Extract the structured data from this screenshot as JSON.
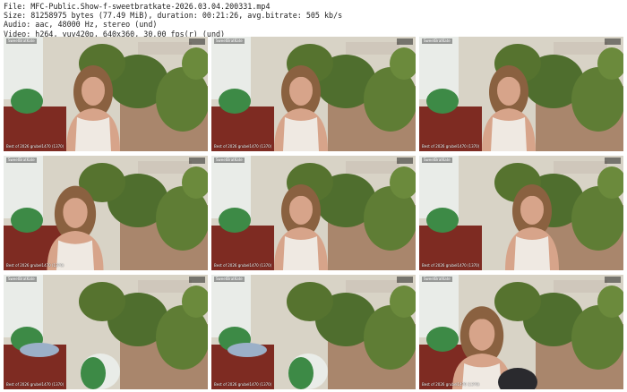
{
  "file_info": {
    "file": "File: MFC-Public.Show-f-sweetbratkate-2026.03.04.200331.mp4",
    "size": "Size: 81258975 bytes (77.49 MiB), duration: 00:21:26, avg.bitrate: 505 kb/s",
    "audio": "Audio: aac, 48000 Hz, stereo (und)",
    "video": "Video: h264, yuv420p, 640x360, 30.00 fps(r) (und)"
  },
  "thumbnails": [
    {
      "pose": "center",
      "top_left": "SweetBratKate",
      "bottom_left": "Best of 2026 grubel1470 (1370)"
    },
    {
      "pose": "center",
      "top_left": "SweetBratKate",
      "bottom_left": "Best of 2026 grubel1470 (1370)"
    },
    {
      "pose": "center",
      "top_left": "SweetBratKate",
      "bottom_left": "Best of 2026 grubel1470 (1370)"
    },
    {
      "pose": "left-lean",
      "top_left": "SweetBratKate",
      "bottom_left": "Best of 2026 grubel1470 (1370)"
    },
    {
      "pose": "center",
      "top_left": "SweetBratKate",
      "bottom_left": "Best of 2026 grubel1470 (1370)"
    },
    {
      "pose": "right",
      "top_left": "SweetBratKate",
      "bottom_left": "Best of 2026 grubel1470 (1370)"
    },
    {
      "pose": "empty",
      "top_left": "SweetBratKate",
      "bottom_left": "Best of 2026 grubel1470 (1370)"
    },
    {
      "pose": "empty",
      "top_left": "SweetBratKate",
      "bottom_left": "Best of 2026 grubel1470 (1370)"
    },
    {
      "pose": "close-left",
      "top_left": "SweetBratKate",
      "bottom_left": "Best of 2026 grubel1470 (1370)"
    }
  ],
  "colors": {
    "wall": "#d8d3c6",
    "window": "#e9ece8",
    "chair": "#7e2b22",
    "pillow": "#3d8a46",
    "foliage": "#4f6e2e",
    "skin": "#d7a48a",
    "hair": "#8a6140",
    "top": "#efe9e2",
    "shelf": "#a9866c"
  }
}
